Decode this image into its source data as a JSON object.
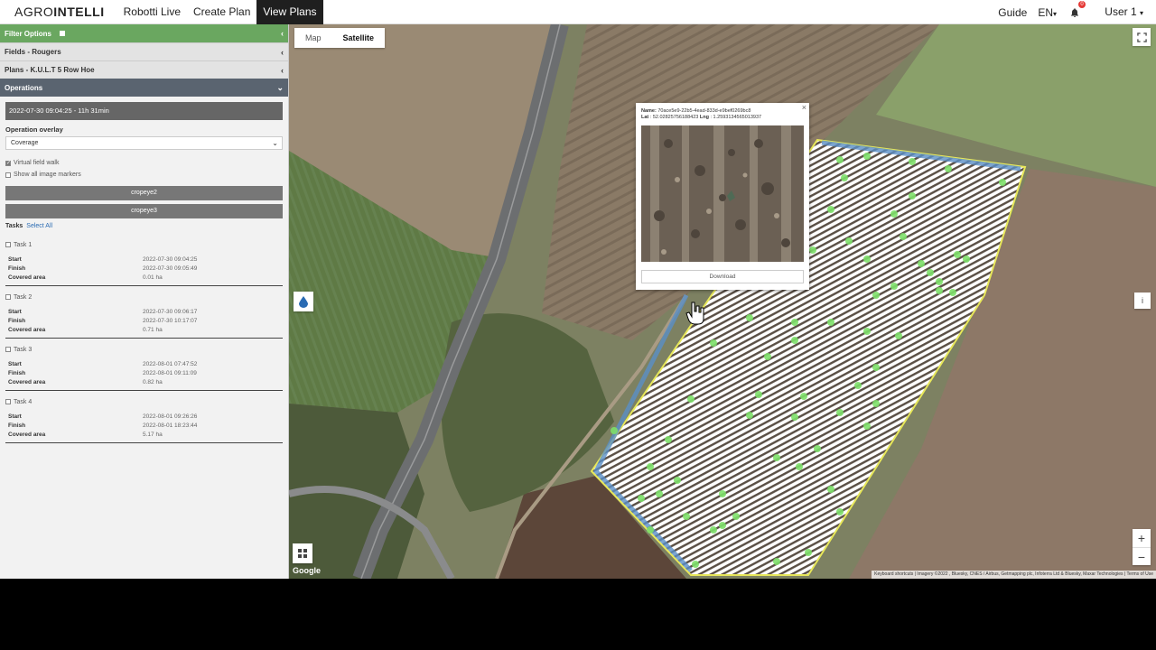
{
  "nav": {
    "logo_light": "AGRO",
    "logo_bold": "INTELLI",
    "links": [
      "Robotti Live",
      "Create Plan",
      "View Plans"
    ],
    "active_index": 2,
    "guide": "Guide",
    "language": "EN",
    "notification_count": "0",
    "user": "User 1"
  },
  "sidebar": {
    "filter_options": "Filter Options",
    "fields": "Fields - Rougers",
    "plans": "Plans - K.U.L.T 5 Row Hoe",
    "operations": "Operations",
    "operation_time": "2022-07-30 09:04:25 - 11h 31min",
    "overlay_label": "Operation overlay",
    "overlay_value": "Coverage",
    "virtual_walk": "Virtual field walk",
    "virtual_walk_checked": true,
    "show_markers": "Show all image markers",
    "show_markers_checked": false,
    "buttons": [
      "cropeye2",
      "cropeye3"
    ],
    "tasks_label": "Tasks",
    "select_all": "Select All",
    "start_label": "Start",
    "finish_label": "Finish",
    "covered_label": "Covered area",
    "tasks": [
      {
        "name": "Task 1",
        "start": "2022-07-30 09:04:25",
        "finish": "2022-07-30 09:05:49",
        "area": "0.01 ha"
      },
      {
        "name": "Task 2",
        "start": "2022-07-30 09:06:17",
        "finish": "2022-07-30 10:17:07",
        "area": "0.71 ha"
      },
      {
        "name": "Task 3",
        "start": "2022-08-01 07:47:52",
        "finish": "2022-08-01 09:11:09",
        "area": "0.82 ha"
      },
      {
        "name": "Task 4",
        "start": "2022-08-01 09:26:26",
        "finish": "2022-08-01 18:23:44",
        "area": "5.17 ha"
      }
    ]
  },
  "map": {
    "type_map": "Map",
    "type_satellite": "Satellite",
    "selected_type": "Satellite",
    "google": "Google",
    "attribution": "Keyboard shortcuts  |  Imagery ©2022 , Bluesky, CNES / Airbus, Getmapping plc, Infoterra Ltd & Bluesky, Maxar Technologies  |  Terms of Use",
    "popup": {
      "name_label": "Name:",
      "name": "70ace5e9-22b5-4ead-833d-e9bef0269bc8",
      "lat_label": "Lat",
      "lat": "52.02825756188423",
      "lng_label": "Lng",
      "lng": "1.2593134565013937",
      "download": "Download"
    },
    "zoom_in": "+",
    "zoom_out": "−",
    "info": "i"
  },
  "colors": {
    "filter_green": "#6aa760",
    "operations_header": "#5a6470",
    "coverage_marker": "#7ee06a",
    "field_outline": "#e8e85a"
  }
}
